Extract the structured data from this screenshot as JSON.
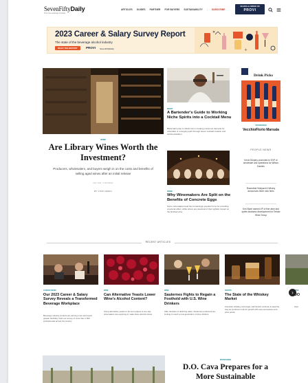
{
  "header": {
    "logo_light": "SevenFifty",
    "logo_bold": "Daily",
    "tagline": "The inner workings of drinks",
    "nav": [
      "ARTICLES",
      "GUIDES",
      "PARTNER",
      "FOR BUYERS",
      "SUSTAINABILITY",
      "|",
      "SUBSCRIBE"
    ],
    "cta_line1": "SEARCH & ORDER ON",
    "cta_line2": "PROVI"
  },
  "banner": {
    "title": "2023 Career & Salary Survey Report",
    "subtitle": "The state of the beverage alcohol industry",
    "button": "READ THE REPORT",
    "provi": "PROVI",
    "sff": "SevenFiftyDaily"
  },
  "feature": {
    "tag": "WINE",
    "title": "Are Library Wines Worth the Investment?",
    "description": "Producers, wholesalers, and buyers weigh in on the costs and benefits of selling aged wines after an initial release",
    "date": "MAY 2023 · 6 MIN READ",
    "byline": "BY VICKI DENIG"
  },
  "middle": [
    {
      "tag": "BEER",
      "title": "A Bartender's Guide to Working Niche Spirits into a Cocktail Menu",
      "description": "Bartenders play a critical role in creating consumer demand for unfamiliar or emerging spirit through clever cocktail creation and social education"
    },
    {
      "tag": "WINE",
      "title": "Why Winemakers Are Split on the Benefits of Concrete Eggs",
      "description": "Some winemakers laud the increasingly popular forms for providing a textural effect, while others are skeptical of their stylistic impact on the finished wine"
    }
  ],
  "right": {
    "pick_title": "Drink Picks",
    "tag": "SPONSORED",
    "title": "VecchioFlorio Marsala",
    "people_news_head": "PEOPLE NEWS",
    "people_news": [
      "Kevin Murphy promoted to EVP of wholesale and operations for Wilson Daniels",
      "Rosenthal Vineyard & Winery announces three new hires",
      "Kim Stare named VP of fine wine and spirits business development for Terlato Wine Group"
    ]
  },
  "recent": {
    "label": "RECENT ARTICLES",
    "cards": [
      {
        "tag": "CAREER NEWS",
        "title": "Our 2023 Career & Salary Survey Reveals a Transformed Beverage Workplace",
        "description": "Beverage industry workers are earning more and report greater flexibility, finds our survey of more than 1,000 professionals across the country"
      },
      {
        "tag": "WINE",
        "title": "Can Alternative Yeasts Lower Wine's Alcohol Content?",
        "description": "Using alternative yeasts to ferment grapes is one way winemakers are exploring to make lower-alcohol wines"
      },
      {
        "tag": "WINE",
        "title": "Sauternes Fights to Regain a Foothold with U.S. Wine Drinkers",
        "description": "After decades of declining sales, Sauternes producers are looking to reach a new generation of wine drinkers"
      },
      {
        "tag": "SPIRITS",
        "title": "The State of the Whiskey Market",
        "description": "American whiskey and single malt Scotch continue to lead the way as producers look for growth with new expressions and price points"
      },
      {
        "tag": "WINE",
        "title": "DO",
        "description": "Sust"
      }
    ]
  },
  "bottom": {
    "tag": "SPONSORED",
    "title": "D.O. Cava Prepares for a More Sustainable"
  }
}
